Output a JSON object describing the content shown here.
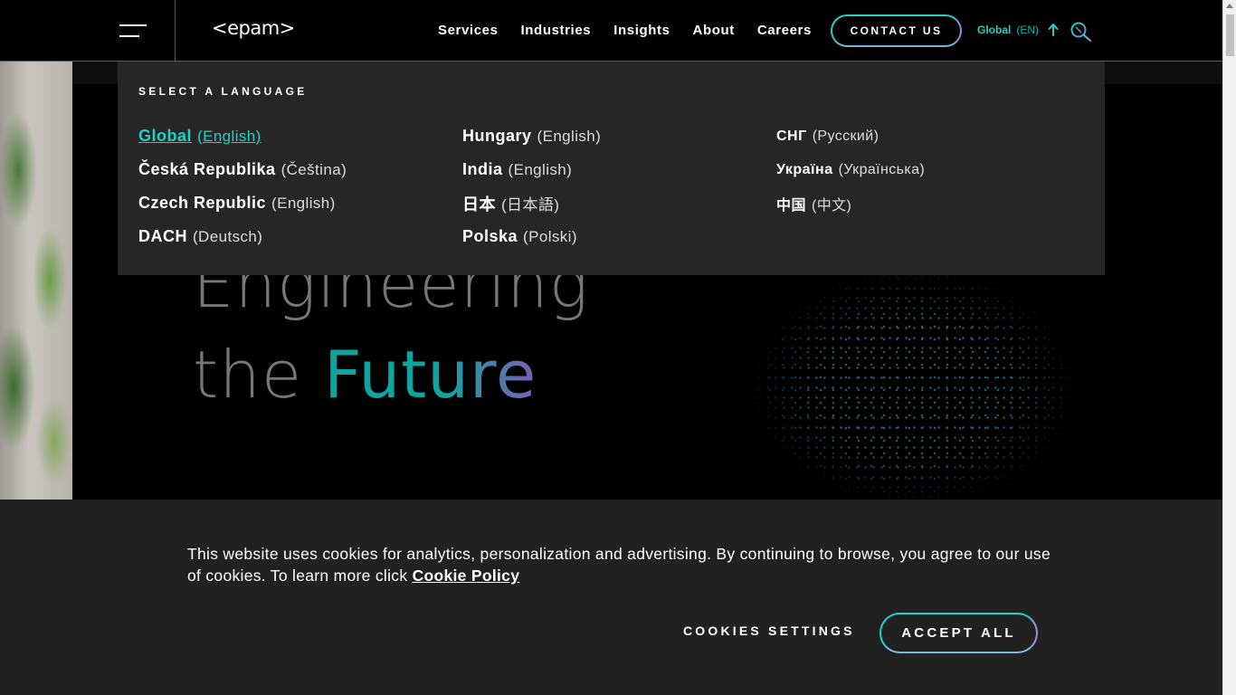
{
  "header": {
    "logo": "<epam>",
    "nav": [
      "Services",
      "Industries",
      "Insights",
      "About",
      "Careers"
    ],
    "contact_label": "CONTACT US",
    "lang_current": "Global",
    "lang_code": "(EN)",
    "icons": {
      "menu": "hamburger-icon",
      "search": "search-icon",
      "toggle": "arrow-up-icon"
    }
  },
  "language_panel": {
    "title": "SELECT A LANGUAGE",
    "columns": [
      [
        {
          "name": "Global",
          "lang": "(English)",
          "active": true
        },
        {
          "name": "Česká Republika",
          "lang": "(Čeština)"
        },
        {
          "name": "Czech Republic",
          "lang": "(English)"
        },
        {
          "name": "DACH",
          "lang": "(Deutsch)"
        }
      ],
      [
        {
          "name": "Hungary",
          "lang": "(English)"
        },
        {
          "name": "India",
          "lang": "(English)"
        },
        {
          "name": "日本",
          "lang": "(日本語)"
        },
        {
          "name": "Polska",
          "lang": "(Polski)"
        }
      ],
      [
        {
          "name": "СНГ",
          "lang": "(Русский)"
        },
        {
          "name": "Україна",
          "lang": "(Українська)"
        },
        {
          "name": "中国",
          "lang": "(中文)"
        }
      ]
    ]
  },
  "hero": {
    "line1": "Engineering",
    "line2_prefix": "the",
    "line2_highlight": "Future"
  },
  "cookie": {
    "text": "This website uses cookies for analytics, personalization and advertising. By continuing to browse, you agree to our use of cookies. To learn more click",
    "link": "Cookie Policy",
    "settings_label": "COOKIES SETTINGS",
    "accept_label": "ACCEPT ALL"
  },
  "colors": {
    "accent": "#1fd2c6",
    "accent_purple": "#9b86e0",
    "panel_bg": "#262626",
    "banner_bg": "#212121"
  }
}
